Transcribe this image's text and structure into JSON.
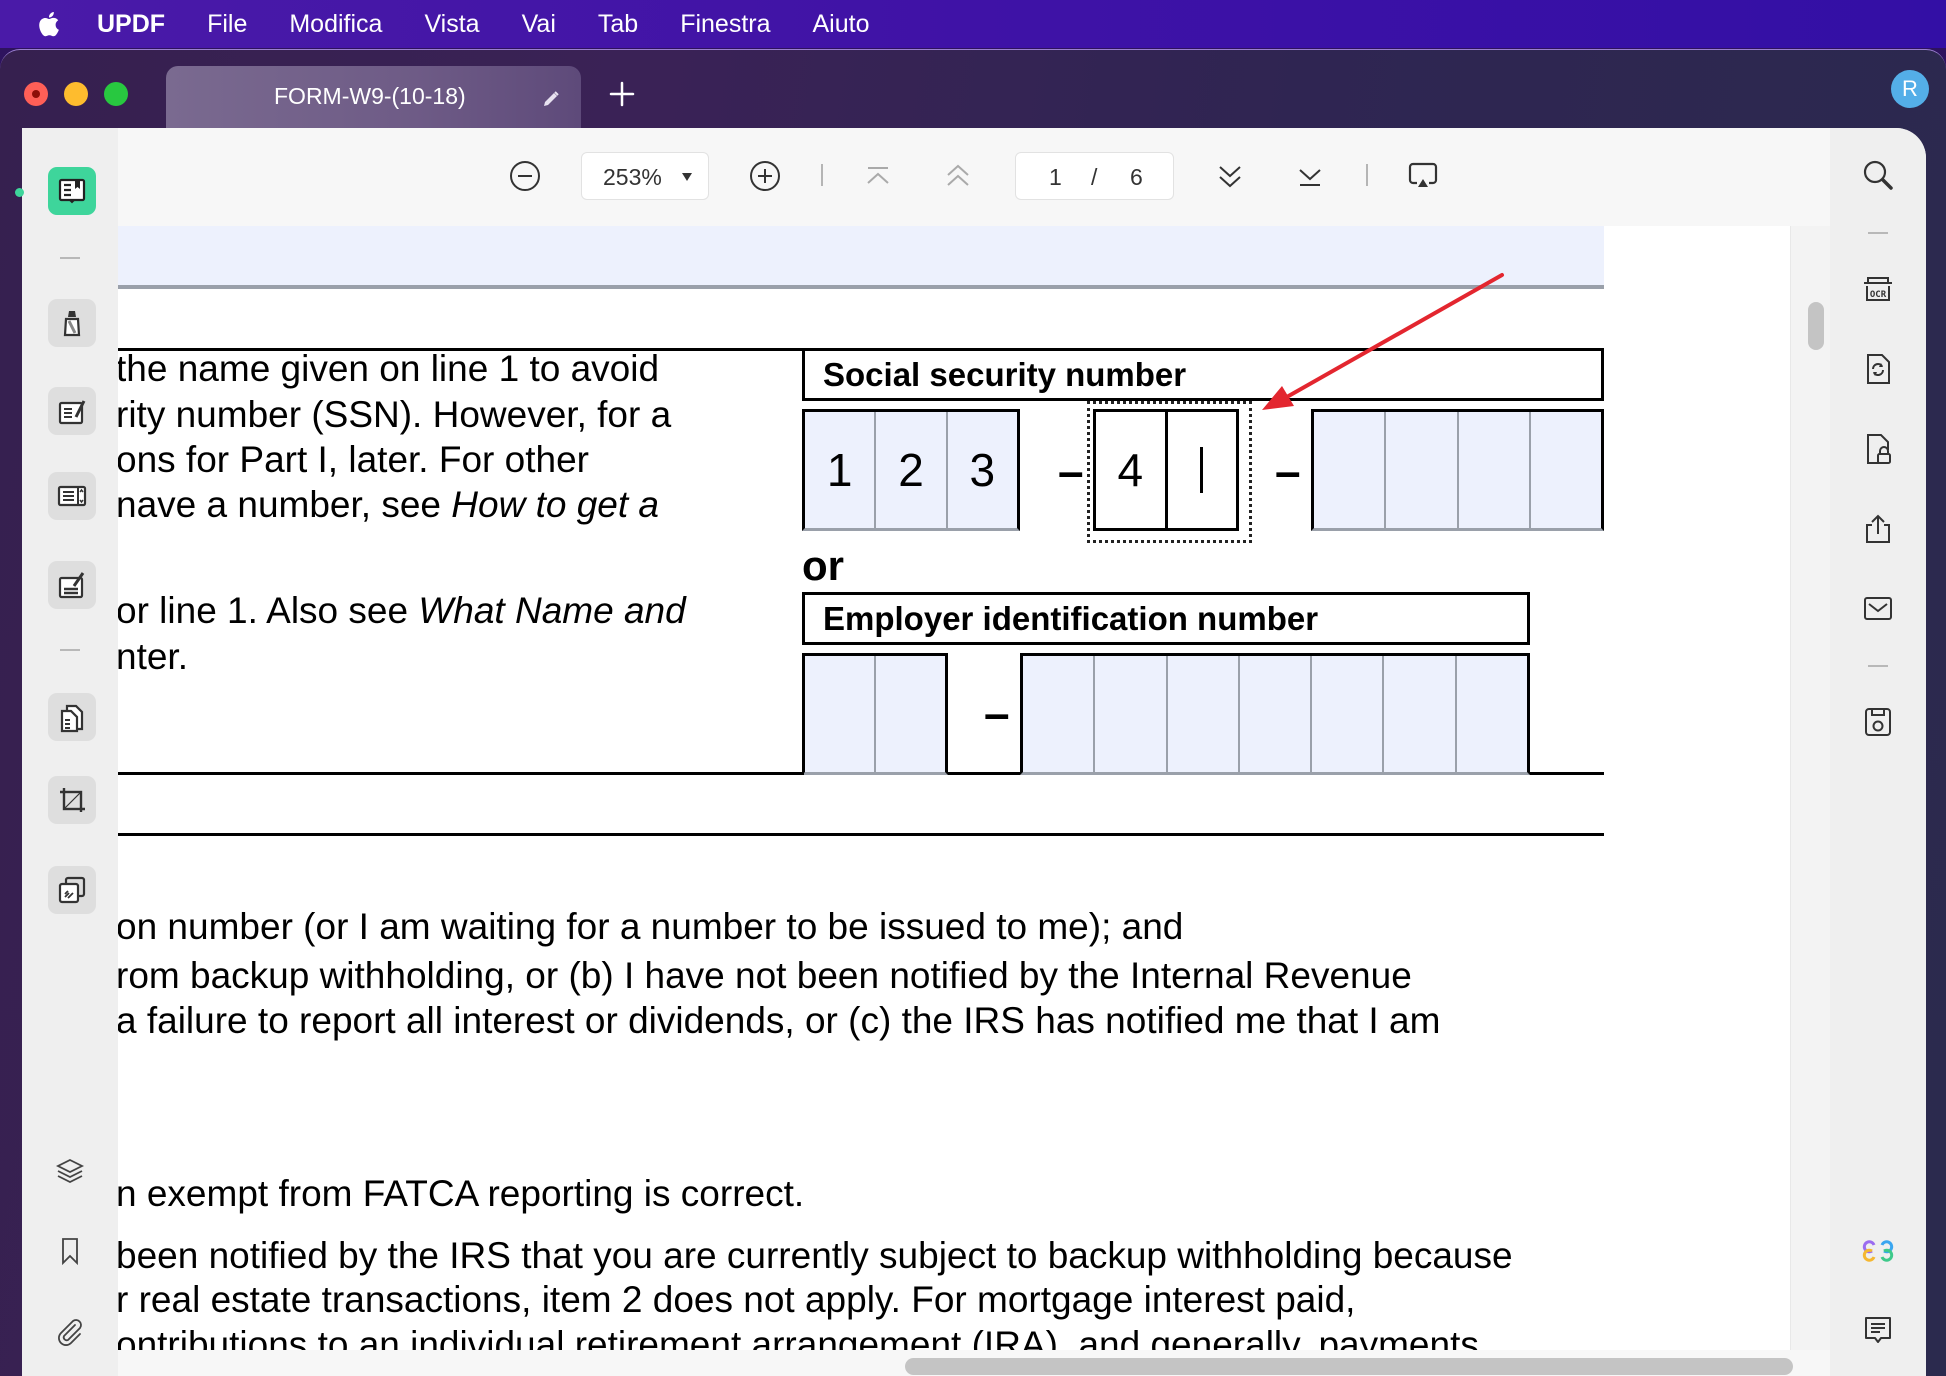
{
  "menubar": {
    "app_name": "UPDF",
    "items": [
      "File",
      "Modifica",
      "Vista",
      "Vai",
      "Tab",
      "Finestra",
      "Aiuto"
    ]
  },
  "window": {
    "tab_title": "FORM-W9-(10-18)",
    "avatar_initial": "R"
  },
  "toolbar": {
    "zoom_value": "253%",
    "current_page": "1",
    "page_separator": "/",
    "total_pages": "6"
  },
  "left_sidebar": {
    "items": [
      "reader",
      "comment",
      "edit",
      "form",
      "sign",
      "organize-pages",
      "crop",
      "page-tools"
    ],
    "bottom_items": [
      "layers",
      "bookmark",
      "attachment"
    ]
  },
  "right_sidebar": {
    "items": [
      "search",
      "ocr",
      "convert",
      "protect",
      "share",
      "email",
      "save",
      "ai-assistant",
      "comments-panel"
    ]
  },
  "document": {
    "left_text_lines": [
      {
        "plain": "the name given on line 1 to avoid",
        "italic": ""
      },
      {
        "plain": "rity number (SSN). However, for a",
        "italic": ""
      },
      {
        "plain": "ons for Part I, later. For other",
        "italic": ""
      },
      {
        "plain": "nave a number, see ",
        "italic": "How to get a"
      },
      {
        "plain": "or line 1. Also see ",
        "italic": "What Name and"
      },
      {
        "plain": "nter.",
        "italic": ""
      }
    ],
    "ssn": {
      "label": "Social security number",
      "group1": [
        "1",
        "2",
        "3"
      ],
      "group2": [
        "4",
        ""
      ],
      "group3": [
        "",
        "",
        "",
        ""
      ],
      "dash": "–"
    },
    "or_label": "or",
    "ein": {
      "label": "Employer identification number",
      "group1": [
        "",
        ""
      ],
      "group2": [
        "",
        "",
        "",
        "",
        "",
        "",
        ""
      ],
      "dash": "–"
    },
    "paragraph_lines": [
      "on number (or I am waiting for a number to be issued to me); and",
      "rom backup withholding, or (b) I have not been notified by the Internal Revenue",
      " a failure to report all interest or dividends, or (c) the IRS has notified me that I am",
      "n exempt from FATCA reporting is correct.",
      " been notified by the IRS that you are currently subject to backup withholding because",
      "r real estate transactions, item 2 does not apply. For mortgage interest paid,",
      "ontributions to an individual retirement arrangement (IRA), and generally, payments"
    ],
    "annotation_color": "#e3262f"
  }
}
